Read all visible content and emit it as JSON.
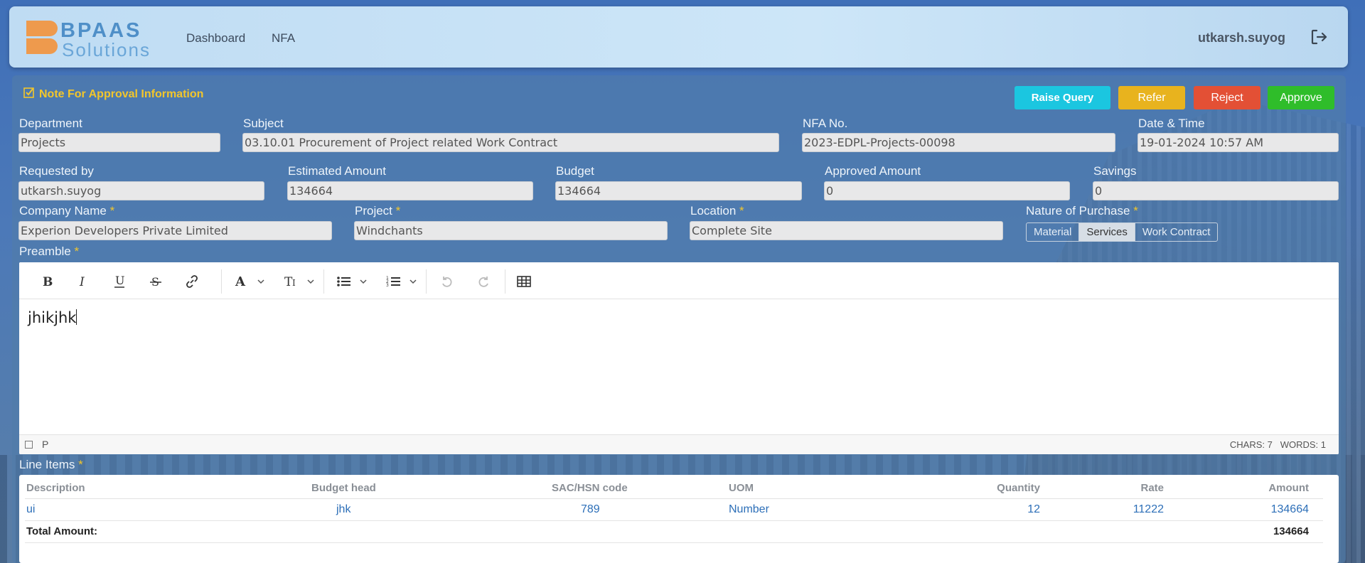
{
  "header": {
    "logo_line1": "BPAAS",
    "logo_line2": "Solutions",
    "nav": [
      "Dashboard",
      "NFA"
    ],
    "user": "utkarsh.suyog",
    "logout_icon": "logout-icon"
  },
  "section_title": "Note For Approval Information",
  "actions": {
    "raise_query": "Raise Query",
    "refer": "Refer",
    "reject": "Reject",
    "approve": "Approve"
  },
  "fields": {
    "department": {
      "label": "Department",
      "value": "Projects"
    },
    "subject": {
      "label": "Subject",
      "value": "03.10.01 Procurement of Project related Work Contract"
    },
    "nfa_no": {
      "label": "NFA No.",
      "value": "2023-EDPL-Projects-00098"
    },
    "date_time": {
      "label": "Date & Time",
      "value": "19-01-2024 10:57 AM"
    },
    "requested_by": {
      "label": "Requested by",
      "value": "utkarsh.suyog"
    },
    "estimated_amount": {
      "label": "Estimated Amount",
      "value": "134664"
    },
    "budget": {
      "label": "Budget",
      "value": "134664"
    },
    "approved_amount": {
      "label": "Approved Amount",
      "value": "0"
    },
    "savings": {
      "label": "Savings",
      "value": "0"
    },
    "company_name": {
      "label": "Company Name",
      "value": "Experion Developers Private Limited"
    },
    "project": {
      "label": "Project",
      "value": "Windchants"
    },
    "location": {
      "label": "Location",
      "value": "Complete Site"
    },
    "nature_of_purchase": {
      "label": "Nature of Purchase",
      "options": [
        "Material",
        "Services",
        "Work Contract"
      ],
      "selected": "Services"
    }
  },
  "required_mark": "*",
  "preamble": {
    "label": "Preamble",
    "content": "jhikjhk",
    "status_block": "P",
    "chars": "CHARS: 7",
    "words": "WORDS: 1",
    "toolbar_icons": [
      "bold-icon",
      "italic-icon",
      "underline-icon",
      "strikethrough-icon",
      "link-icon",
      "font-color-icon",
      "font-size-icon",
      "bullet-list-icon",
      "numbered-list-icon",
      "undo-icon",
      "redo-icon",
      "table-icon"
    ]
  },
  "line_items": {
    "label": "Line Items",
    "columns": [
      "Description",
      "Budget head",
      "SAC/HSN code",
      "UOM",
      "Quantity",
      "Rate",
      "Amount"
    ],
    "rows": [
      {
        "description": "ui",
        "budget_head": "jhk",
        "sac_hsn": "789",
        "uom": "Number",
        "quantity": "12",
        "rate": "11222",
        "amount": "134664"
      }
    ],
    "total_label": "Total Amount:",
    "total_value": "134664"
  },
  "colors": {
    "accent_yellow": "#f2c62b",
    "raise_query": "#1bc6e0",
    "refer": "#e8b31e",
    "reject": "#e35035",
    "approve": "#2fbd2a",
    "logo_orange": "#ee9a4d",
    "logo_blue": "#4f8fc8"
  }
}
